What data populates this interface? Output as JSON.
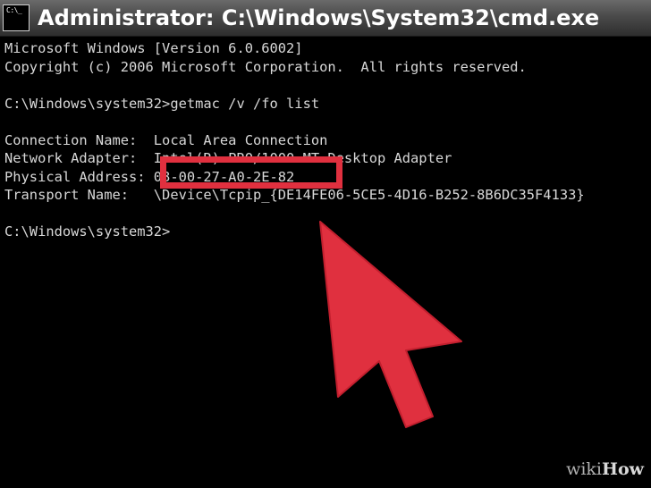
{
  "window": {
    "title": "Administrator: C:\\Windows\\System32\\cmd.exe",
    "icon": "cmd-prompt-icon",
    "icon_text": "C:\\_"
  },
  "console": {
    "lines": [
      "Microsoft Windows [Version 6.0.6002]",
      "Copyright (c) 2006 Microsoft Corporation.  All rights reserved.",
      "",
      "C:\\Windows\\system32>getmac /v /fo list",
      "",
      "Connection Name:  Local Area Connection",
      "Network Adapter:  Intel(R) PRO/1000 MT Desktop Adapter",
      "Physical Address: 08-00-27-A0-2E-82",
      "Transport Name:   \\Device\\Tcpip_{DE14FE06-5CE5-4D16-B252-8B6DC35F4133}",
      "",
      "C:\\Windows\\system32>"
    ]
  },
  "annotation": {
    "highlighted_value": "08-00-27-A0-2E-82",
    "color": "#e0303f"
  },
  "watermark": {
    "part1": "wiki",
    "part2": "How"
  },
  "colors": {
    "console_bg": "#000000",
    "console_text": "#d8d8d8",
    "arrow": "#e0303f"
  }
}
